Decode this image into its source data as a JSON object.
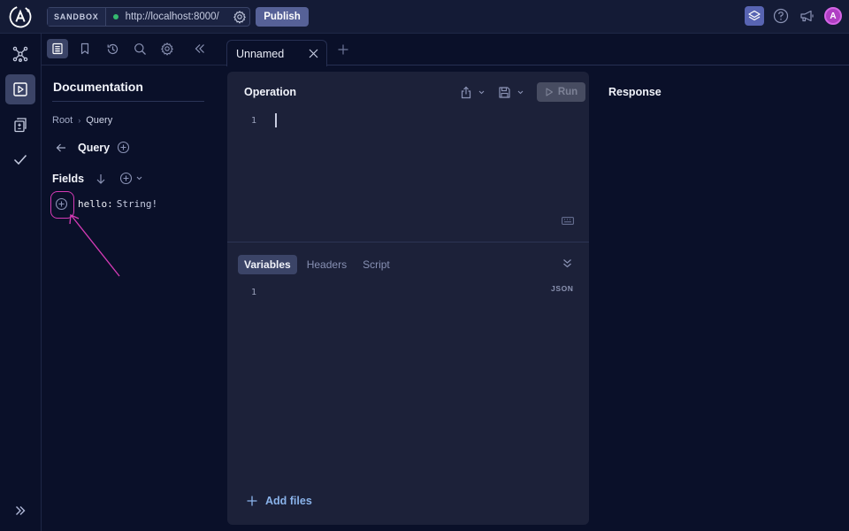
{
  "topbar": {
    "sandbox_label": "SANDBOX",
    "endpoint_url": "http://localhost:8000/",
    "endpoint_status_color": "#35b96f",
    "publish_label": "Publish",
    "avatar_initial": "A"
  },
  "rail": {
    "items": [
      "schema",
      "explorer",
      "checks-diff",
      "checks"
    ],
    "active": "explorer"
  },
  "doc_toolbar": {
    "items": [
      "documentation",
      "collections",
      "history",
      "search",
      "settings",
      "collapse"
    ],
    "active": "documentation"
  },
  "documentation": {
    "title": "Documentation",
    "breadcrumb": {
      "root": "Root",
      "separator": "›",
      "current": "Query"
    },
    "type_name": "Query",
    "fields_label": "Fields",
    "fields": [
      {
        "name": "hello:",
        "type": "String!"
      }
    ]
  },
  "tabs": {
    "items": [
      {
        "label": "Unnamed",
        "active": true
      }
    ]
  },
  "operation": {
    "title": "Operation",
    "run_label": "Run",
    "line_numbers": [
      "1"
    ]
  },
  "variables": {
    "tabs": [
      "Variables",
      "Headers",
      "Script"
    ],
    "active_tab": "Variables",
    "format_label": "JSON",
    "line_numbers": [
      "1"
    ],
    "add_files_label": "Add files"
  },
  "response": {
    "title": "Response"
  },
  "colors": {
    "accent": "#5864b2",
    "annotation": "#d53bb6",
    "link": "#8ab3ea"
  }
}
